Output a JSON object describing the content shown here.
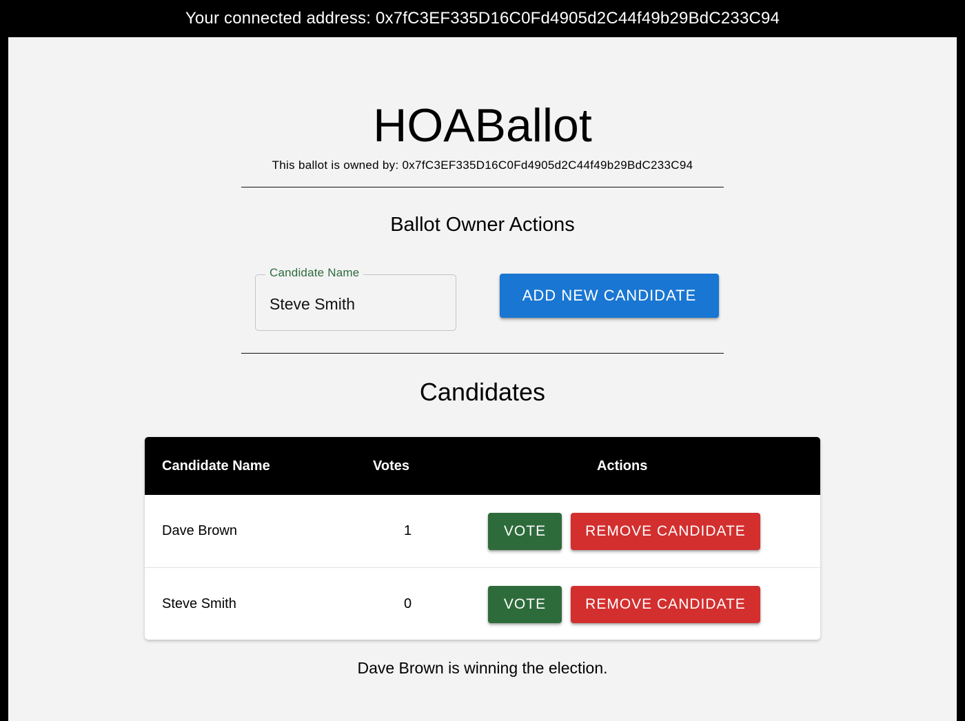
{
  "topbar": {
    "connected_address": "Your connected address: 0x7fC3EF335D16C0Fd4905d2C44f49b29BdC233C94"
  },
  "header": {
    "title": "HOABallot",
    "owner_line": "This ballot is owned by: 0x7fC3EF335D16C0Fd4905d2C44f49b29BdC233C94"
  },
  "owner_actions": {
    "heading": "Ballot Owner Actions",
    "field_label": "Candidate Name",
    "field_value": "Steve Smith",
    "add_button": "ADD NEW CANDIDATE"
  },
  "candidates": {
    "heading": "Candidates",
    "columns": [
      "Candidate Name",
      "Votes",
      "Actions"
    ],
    "rows": [
      {
        "name": "Dave Brown",
        "votes": "1",
        "vote_label": "VOTE",
        "remove_label": "REMOVE CANDIDATE"
      },
      {
        "name": "Steve Smith",
        "votes": "0",
        "vote_label": "VOTE",
        "remove_label": "REMOVE CANDIDATE"
      }
    ]
  },
  "status": "Dave Brown is winning the election.",
  "colors": {
    "primary": "#1976d2",
    "vote": "#2e6b3b",
    "remove": "#d32f2f",
    "header_bg": "#000000",
    "page_bg": "#f3f3f4"
  }
}
